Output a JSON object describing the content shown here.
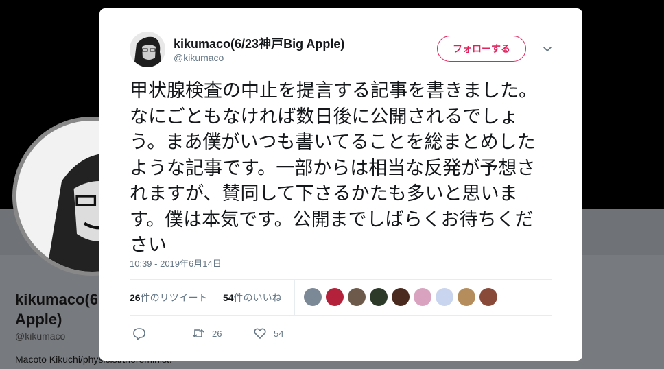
{
  "background_profile": {
    "name_line1": "kikumaco(6",
    "name_line2": "Apple)",
    "handle": "@kikumaco",
    "bio": "Macoto Kikuchi/physicist/thereminist."
  },
  "tweet": {
    "display_name": "kikumaco(6/23神戸Big Apple)",
    "handle": "@kikumaco",
    "follow_label": "フォローする",
    "text": "甲状腺検査の中止を提言する記事を書きました。なにごともなければ数日後に公開されるでしょう。まあ僕がいつも書いてることを総まとめしたような記事です。一部からは相当な反発が予想されますが、賛同して下さるかたも多いと思います。僕は本気です。公開までしばらくお待ちください",
    "timestamp": "10:39 - 2019年6月14日",
    "retweets_count": "26",
    "retweets_label": "件のリツイート",
    "likes_count": "54",
    "likes_label": "件のいいね",
    "action_retweet_count": "26",
    "action_like_count": "54"
  },
  "colors": {
    "accent": "#e0245e",
    "text": "#14171a",
    "muted": "#657786",
    "divider": "#e6ecf0"
  },
  "icons": {
    "reply": "reply-icon",
    "retweet": "retweet-icon",
    "like": "heart-icon",
    "more": "chevron-down-icon"
  }
}
